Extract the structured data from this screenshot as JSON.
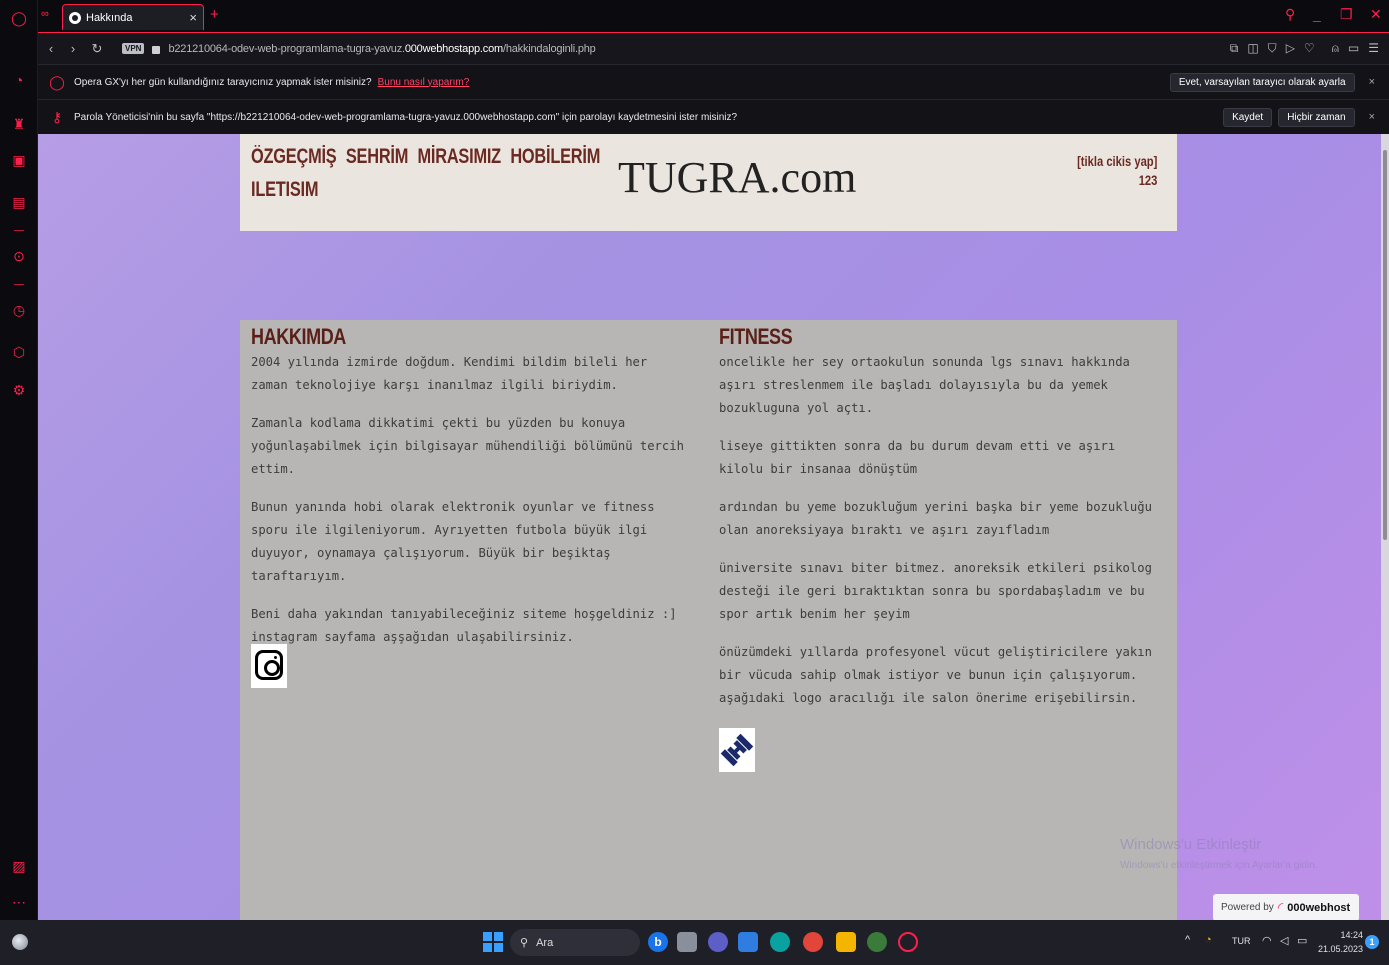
{
  "browser": {
    "tab_title": "Hakkında",
    "tab_close": "×",
    "new_tab": "+",
    "vpn_badge": "VPN",
    "url_prefix": "b221210064-odev-web-programlama-tugra-yavuz.",
    "url_domain": "000webhostapp.com",
    "url_suffix": "/hakkindaloginli.php"
  },
  "infobar_default": {
    "message": "Opera GX'yı her gün kullandığınız tarayıcınız yapmak ister misiniz?",
    "link": "Bunu nasıl yaparım?",
    "button": "Evet, varsayılan tarayıcı olarak ayarla",
    "close": "×"
  },
  "infobar_password": {
    "message": "Parola Yöneticisi'nin bu sayfa \"https://b221210064-odev-web-programlama-tugra-yavuz.000webhostapp.com\" için parolayı kaydetmesini ister misiniz?",
    "save_button": "Kaydet",
    "never_button": "Hiçbir zaman",
    "close": "×"
  },
  "site": {
    "menu": [
      "ÖZGEÇMİŞ",
      "SEHRİM",
      "MİRASIMIZ",
      "HOBİLERİM",
      "ILETISIM"
    ],
    "title": "TUGRA.com",
    "logout": "[tikla cikis yap]",
    "username": "123"
  },
  "about": {
    "heading": "HAKKIMDA",
    "paragraphs": [
      "2004 yılında izmirde doğdum. Kendimi bildim bileli her zaman teknolojiye karşı inanılmaz ilgili biriydim.",
      "Zamanla kodlama dikkatimi çekti bu yüzden bu konuya yoğunlaşabilmek için bilgisayar mühendiliği bölümünü tercih ettim.",
      "Bunun yanında hobi olarak elektronik oyunlar ve fitness sporu ile ilgileniyorum. Ayrıyetten futbola büyük ilgi duyuyor, oynamaya çalışıyorum. Büyük bir beşiktaş taraftarıyım.",
      "Beni daha yakından tanıyabileceğiniz siteme hoşgeldiniz :] instagram sayfama aşşağıdan ulaşabilirsiniz."
    ]
  },
  "fitness": {
    "heading": "FITNESS",
    "paragraphs": [
      "oncelikle her sey ortaokulun sonunda lgs sınavı hakkında aşırı streslenmem ile başladı dolayısıyla bu da yemek bozukluguna yol açtı.",
      "liseye gittikten sonra da bu durum devam etti ve aşırı kilolu bir insanaa dönüştüm",
      "ardından bu yeme bozukluğum yerini başka bir yeme bozukluğu olan anoreksiyaya bıraktı ve aşırı zayıfladım",
      "üniversite sınavı biter bitmez. anoreksik etkileri psikolog desteği ile geri bıraktıktan sonra bu spordabaşladım ve bu spor artık benim her şeyim",
      "önüzümdeki yıllarda profesyonel vücut geliştiricilere yakın bir vücuda sahip olmak istiyor ve bunun için çalışıyorum. aşağıdaki logo aracılığı ile salon önerime erişebilirsin."
    ]
  },
  "watermark": {
    "line1": "Windows'u Etkinleştir",
    "line2": "Windows'u etkinleştirmek için Ayarlar'a gidin."
  },
  "powered": {
    "label": "Powered by",
    "brand": "000webhost"
  },
  "taskbar": {
    "search_placeholder": "Ara",
    "language": "TUR",
    "time": "14:24",
    "date": "21.05.2023",
    "notification_count": "1"
  },
  "colors": {
    "accent": "#ff1f4d",
    "header_bg": "#ebe5df",
    "content_bg": "#b8b6b4",
    "heading_text": "#5a1f16"
  }
}
